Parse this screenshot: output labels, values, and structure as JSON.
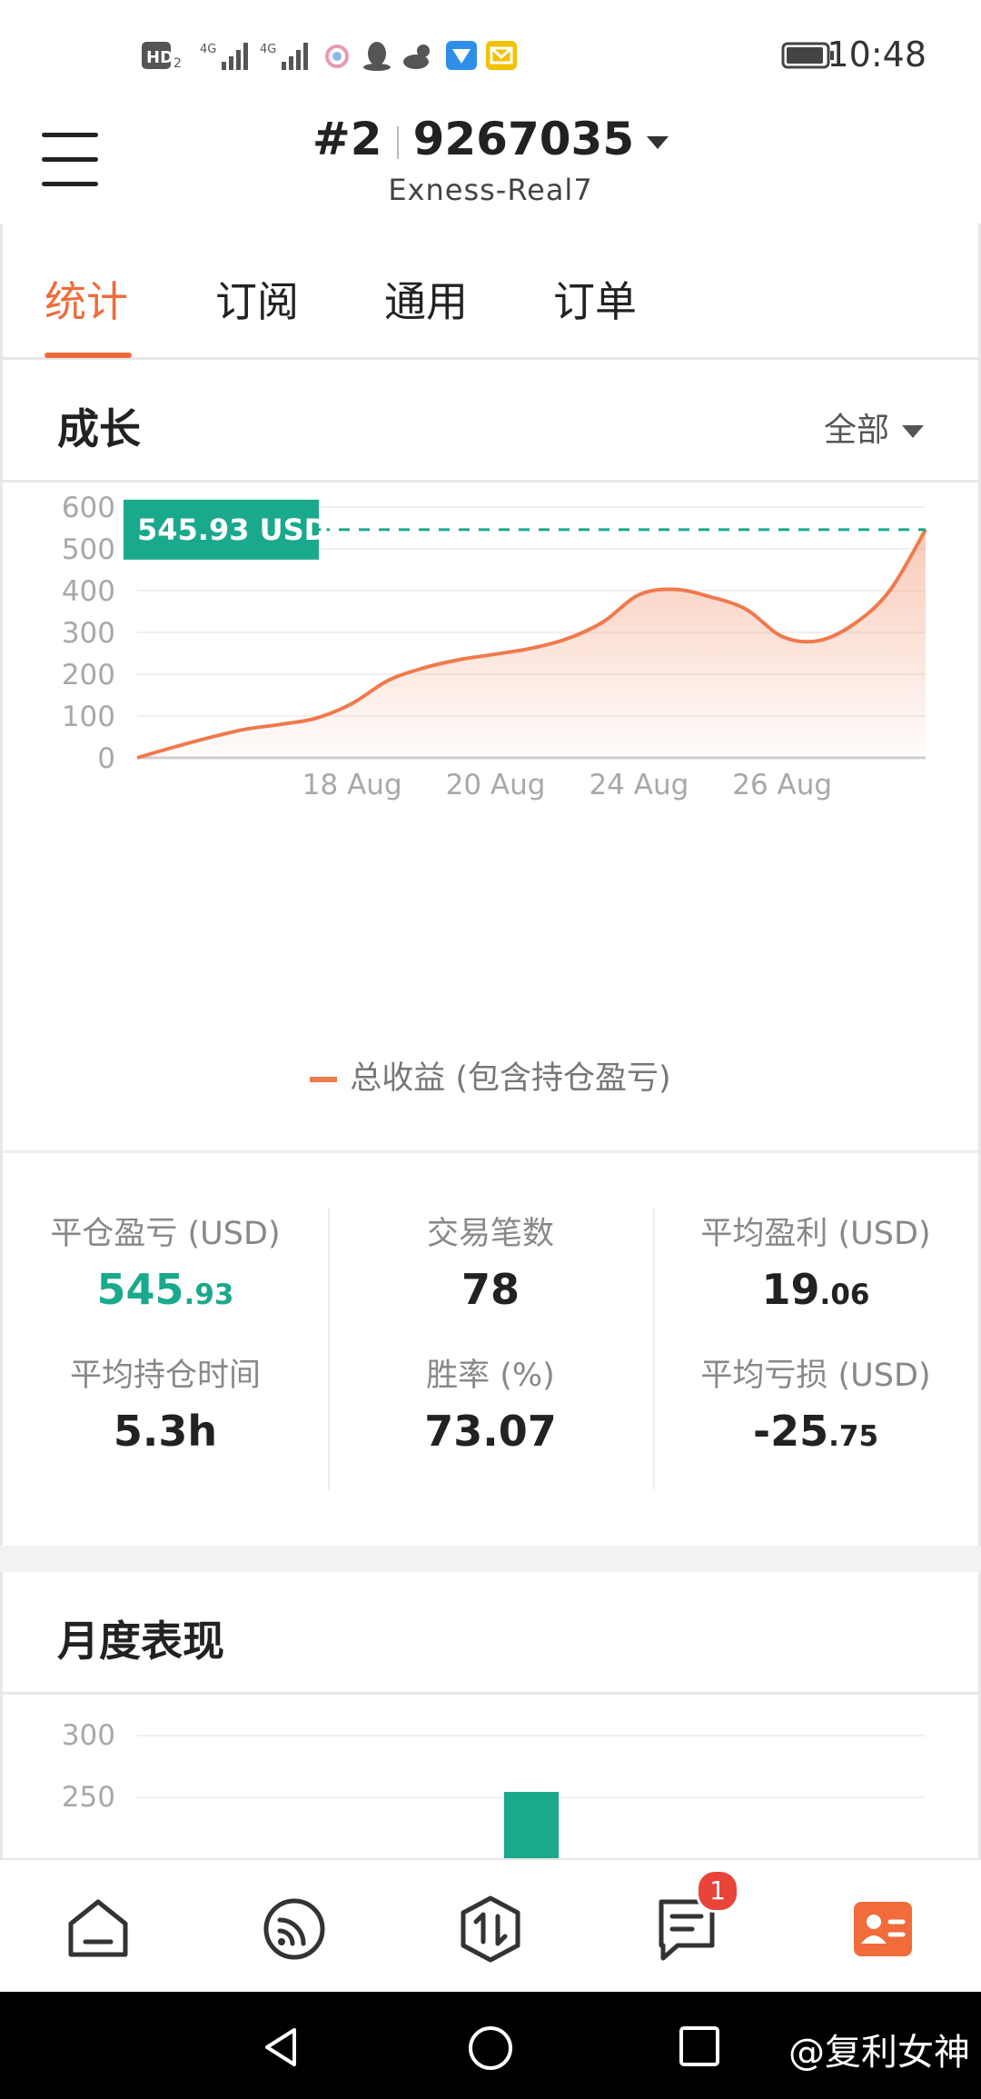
{
  "status_bar": {
    "time": "10:48",
    "icons": [
      "hd-icon",
      "signal-4g-icon",
      "signal-4g-icon",
      "app-icon",
      "qq-icon",
      "weather-icon",
      "app-icon",
      "mail-icon",
      "battery-icon"
    ]
  },
  "header": {
    "account_prefix": "#2",
    "account_number": "9267035",
    "server": "Exness-Real7"
  },
  "tabs": [
    {
      "label": "统计",
      "active": true
    },
    {
      "label": "订阅",
      "active": false
    },
    {
      "label": "通用",
      "active": false
    },
    {
      "label": "订单",
      "active": false
    }
  ],
  "growth": {
    "title": "成长",
    "range_label": "全部",
    "legend_label": "总收益 (包含持仓盈亏)",
    "current_value_label": "545.93 USD"
  },
  "chart_data": {
    "type": "area",
    "x_tick_labels": [
      "18 Aug",
      "20 Aug",
      "24 Aug",
      "26 Aug"
    ],
    "x_tick_positions": [
      3,
      5,
      7,
      9
    ],
    "y_ticks": [
      0,
      100,
      200,
      300,
      400,
      500,
      600
    ],
    "ylim": [
      0,
      600
    ],
    "xlim": [
      0,
      11
    ],
    "series": [
      {
        "name": "总收益 (包含持仓盈亏)",
        "x": [
          0,
          0.5,
          1,
          1.5,
          2,
          2.5,
          3,
          3.5,
          4,
          4.5,
          5,
          5.5,
          6,
          6.5,
          7,
          7.5,
          8,
          8.5,
          9,
          9.5,
          10,
          10.5,
          11
        ],
        "y": [
          0,
          25,
          48,
          68,
          80,
          95,
          130,
          185,
          215,
          235,
          248,
          262,
          285,
          325,
          390,
          403,
          385,
          355,
          290,
          280,
          320,
          400,
          545.93
        ],
        "color": "#ef7a4d"
      }
    ],
    "reference_line": {
      "value": 545.93,
      "label": "545.93 USD",
      "color": "#1aa98c"
    }
  },
  "stats": [
    {
      "label": "平仓盈亏 (USD)",
      "int": "545",
      "dec": ".93",
      "color": "#1aa98c"
    },
    {
      "label": "交易笔数",
      "int": "78",
      "dec": ""
    },
    {
      "label": "平均盈利 (USD)",
      "int": "19",
      "dec": ".06"
    },
    {
      "label": "平均持仓时间",
      "int": "5.3h",
      "dec": ""
    },
    {
      "label": "胜率 (%)",
      "int": "73.07",
      "dec": ""
    },
    {
      "label": "平均亏损 (USD)",
      "int": "-25",
      "dec": ".75"
    }
  ],
  "monthly": {
    "title": "月度表现",
    "chart_data": {
      "type": "bar",
      "y_ticks": [
        250,
        300
      ],
      "visible_bar_color": "#1aa98c"
    }
  },
  "bottom_nav": {
    "items": [
      "home-icon",
      "feed-icon",
      "trade-icon",
      "messages-icon",
      "profile-icon"
    ],
    "badge_count": "1",
    "active_color": "#f26b3a"
  },
  "watermark": "@复利女神"
}
